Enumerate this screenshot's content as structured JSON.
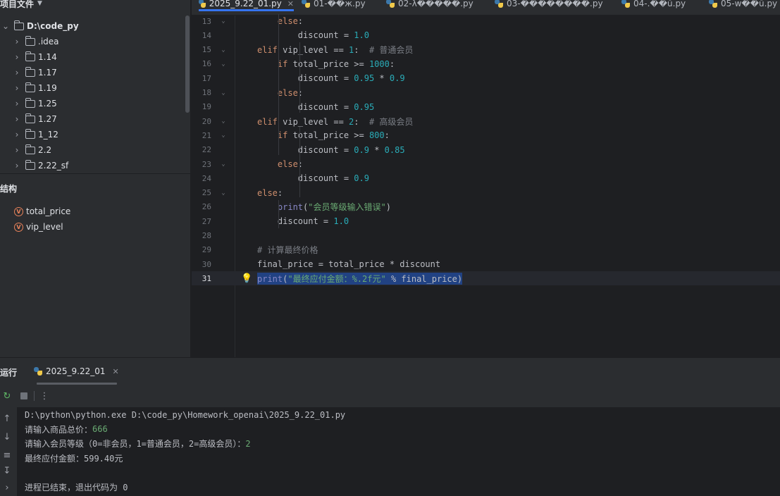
{
  "project": {
    "header": "项目文件",
    "root": "D:\\code_py",
    "folders": [
      ".idea",
      "1.14",
      "1.17",
      "1.19",
      "1.25",
      "1.27",
      "1_12",
      "2.2",
      "2.22_sf"
    ]
  },
  "structure": {
    "title": "结构",
    "items": [
      {
        "badge": "V",
        "name": "total_price"
      },
      {
        "badge": "V",
        "name": "vip_level"
      }
    ]
  },
  "tabs": [
    {
      "label": "2025_9.22_01.py",
      "active": true
    },
    {
      "label": "01-��ж.py",
      "active": false
    },
    {
      "label": "02-λ�����.py",
      "active": false
    },
    {
      "label": "03-��������.py",
      "active": false
    },
    {
      "label": "04-.��ū.py",
      "active": false
    },
    {
      "label": "05-w��ū.py",
      "active": false
    }
  ],
  "editor": {
    "current_line": 31,
    "lines": [
      {
        "n": 13,
        "fold": true,
        "parts": [
          [
            "    else",
            "kw"
          ],
          [
            ":",
            ""
          ]
        ]
      },
      {
        "n": 14,
        "fold": false,
        "parts": [
          [
            "        discount = ",
            ""
          ],
          [
            "1.0",
            "num"
          ]
        ]
      },
      {
        "n": 15,
        "fold": true,
        "parts": [
          [
            "elif ",
            "kw"
          ],
          [
            "vip_level == ",
            ""
          ],
          [
            "1",
            "num"
          ],
          [
            ":  ",
            ""
          ],
          [
            "# 普通会员",
            "cmt"
          ]
        ]
      },
      {
        "n": 16,
        "fold": true,
        "parts": [
          [
            "    if ",
            "kw"
          ],
          [
            "total_price >= ",
            ""
          ],
          [
            "1000",
            "num"
          ],
          [
            ":",
            ""
          ]
        ]
      },
      {
        "n": 17,
        "fold": false,
        "parts": [
          [
            "        discount = ",
            ""
          ],
          [
            "0.95",
            "num"
          ],
          [
            " * ",
            ""
          ],
          [
            "0.9",
            "num"
          ]
        ]
      },
      {
        "n": 18,
        "fold": true,
        "parts": [
          [
            "    else",
            "kw"
          ],
          [
            ":",
            ""
          ]
        ]
      },
      {
        "n": 19,
        "fold": false,
        "parts": [
          [
            "        discount = ",
            ""
          ],
          [
            "0.95",
            "num"
          ]
        ]
      },
      {
        "n": 20,
        "fold": true,
        "parts": [
          [
            "elif ",
            "kw"
          ],
          [
            "vip_level == ",
            ""
          ],
          [
            "2",
            "num"
          ],
          [
            ":  ",
            ""
          ],
          [
            "# 高级会员",
            "cmt"
          ]
        ]
      },
      {
        "n": 21,
        "fold": true,
        "parts": [
          [
            "    if ",
            "kw"
          ],
          [
            "total_price >= ",
            ""
          ],
          [
            "800",
            "num"
          ],
          [
            ":",
            ""
          ]
        ]
      },
      {
        "n": 22,
        "fold": false,
        "parts": [
          [
            "        discount = ",
            ""
          ],
          [
            "0.9",
            "num"
          ],
          [
            " * ",
            ""
          ],
          [
            "0.85",
            "num"
          ]
        ]
      },
      {
        "n": 23,
        "fold": true,
        "parts": [
          [
            "    else",
            "kw"
          ],
          [
            ":",
            ""
          ]
        ]
      },
      {
        "n": 24,
        "fold": false,
        "parts": [
          [
            "        discount = ",
            ""
          ],
          [
            "0.9",
            "num"
          ]
        ]
      },
      {
        "n": 25,
        "fold": true,
        "parts": [
          [
            "else",
            "kw"
          ],
          [
            ":",
            ""
          ]
        ]
      },
      {
        "n": 26,
        "fold": false,
        "parts": [
          [
            "    ",
            ""
          ],
          [
            "print",
            "fn"
          ],
          [
            "(",
            ""
          ],
          [
            "\"会员等级输入错误\"",
            "str"
          ],
          [
            ")",
            ""
          ]
        ]
      },
      {
        "n": 27,
        "fold": false,
        "parts": [
          [
            "    discount = ",
            ""
          ],
          [
            "1.0",
            "num"
          ]
        ]
      },
      {
        "n": 28,
        "fold": false,
        "parts": []
      },
      {
        "n": 29,
        "fold": false,
        "parts": [
          [
            "# 计算最终价格",
            "cmt"
          ]
        ]
      },
      {
        "n": 30,
        "fold": false,
        "parts": [
          [
            "final_price = total_price * discount",
            ""
          ]
        ]
      },
      {
        "n": 31,
        "fold": false,
        "parts": [
          [
            "print",
            "fn"
          ],
          [
            "(",
            ""
          ],
          [
            "\"最终应付金额：%.2f元\"",
            "str"
          ],
          [
            " % final_price)",
            ""
          ]
        ]
      }
    ]
  },
  "run": {
    "title": "运行",
    "tab": "2025_9.22_01",
    "output": [
      {
        "text": "D:\\python\\python.exe D:\\code_py\\Homework_openai\\2025_9.22_01.py",
        "input": ""
      },
      {
        "text": "请输入商品总价：",
        "input": "666"
      },
      {
        "text": "请输入会员等级（0=非会员，1=普通会员，2=高级会员）：",
        "input": "2"
      },
      {
        "text": "最终应付金额：599.40元",
        "input": ""
      },
      {
        "text": "",
        "input": ""
      },
      {
        "text": "进程已结束，退出代码为 0",
        "input": ""
      }
    ]
  }
}
